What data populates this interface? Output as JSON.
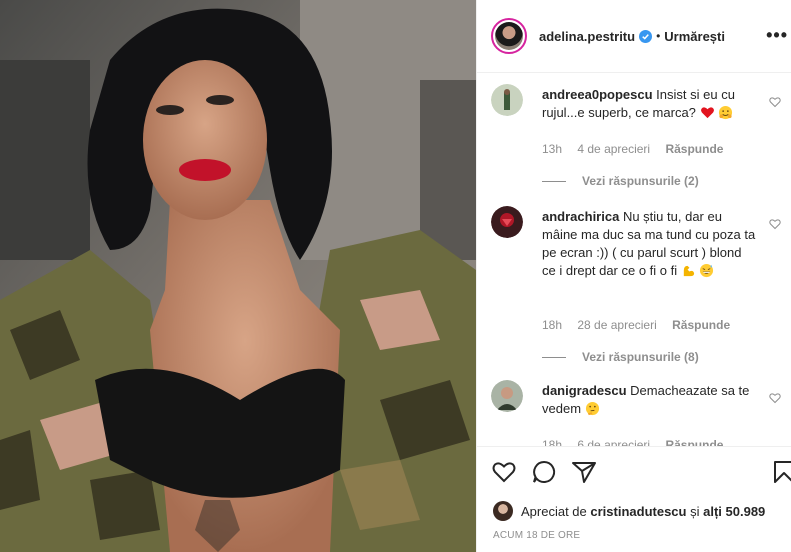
{
  "post": {
    "username": "adelina.pestritu",
    "dot": "•",
    "follow_label": "Urmărești",
    "more_label": "•••"
  },
  "comments": [
    {
      "username": "andreea0popescu",
      "text": "Insist si eu cu rujul...e superb, ce marca?",
      "emojis": [
        "red-heart-emoji",
        "hugging-face-emoji"
      ],
      "time": "13h",
      "date": "4 de aprecieri",
      "reply_label": "Răspunde",
      "view_replies": "Vezi răspunsurile (2)"
    },
    {
      "username": "andrachirica",
      "text": "Nu știu tu, dar eu mâine ma duc sa ma tund cu poza ta pe ecran :)) ( cu parul scurt ) blond ce i drept dar ce o fi o fi",
      "emojis": [
        "flexed-biceps-emoji",
        "grinning-sweat-emoji"
      ],
      "time": "18h",
      "date": "28 de aprecieri",
      "reply_label": "Răspunde",
      "view_replies": "Vezi răspunsurile (8)"
    },
    {
      "username": "danigradescu",
      "text": "Demacheazate sa te vedem",
      "emojis": [
        "thinking-face-emoji"
      ],
      "time": "18h",
      "date": "6 de aprecieri",
      "reply_label": "Răspunde"
    }
  ],
  "likes": {
    "prefix": "Apreciat de",
    "user": "cristinadutescu",
    "middle": "și",
    "others": "alți 50.989"
  },
  "time_ago": "ACUM 18 DE ORE",
  "colors": {
    "text": "#262626",
    "secondary": "#8e8e8e",
    "border": "#efefef",
    "verified": "#3897f0",
    "heart": "#ed4956"
  }
}
